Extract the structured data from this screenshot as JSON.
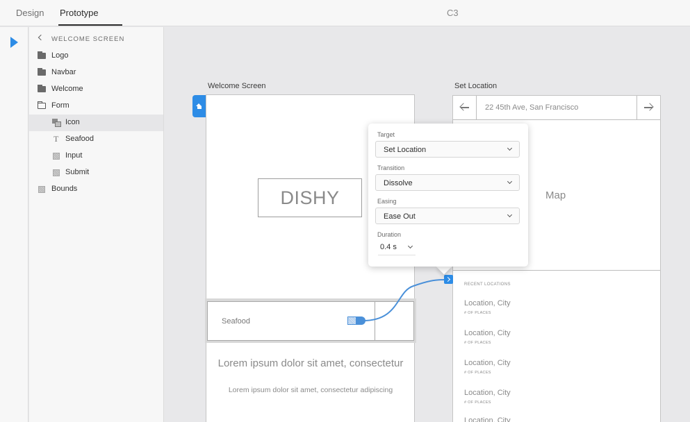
{
  "tabs": {
    "design": "Design",
    "prototype": "Prototype"
  },
  "document_title": "C3",
  "layers_panel": {
    "title": "WELCOME SCREEN",
    "items": [
      {
        "label": "Logo",
        "icon": "folder-filled-icon"
      },
      {
        "label": "Navbar",
        "icon": "folder-filled-icon"
      },
      {
        "label": "Welcome",
        "icon": "folder-filled-icon"
      },
      {
        "label": "Form",
        "icon": "folder-open-icon"
      },
      {
        "label": "Icon",
        "icon": "symbol-icon",
        "selected": true
      },
      {
        "label": "Seafood",
        "icon": "text-icon"
      },
      {
        "label": "Input",
        "icon": "rectangle-icon"
      },
      {
        "label": "Submit",
        "icon": "rectangle-icon"
      },
      {
        "label": "Bounds",
        "icon": "rectangle-icon"
      }
    ]
  },
  "welcome_screen": {
    "title": "Welcome Screen",
    "logo_text": "DISHY",
    "input_label": "Seafood",
    "lorem_big": "Lorem ipsum dolor sit amet, consectetur",
    "lorem_small": "Lorem ipsum dolor sit amet, consectetur adipiscing"
  },
  "set_location": {
    "title": "Set Location",
    "search_value": "22 45th Ave, San Francisco",
    "map_label": "Map",
    "recent_title": "RECENT LOCATIONS",
    "locations": [
      {
        "city": "Location, City",
        "places": "# OF PLACES"
      },
      {
        "city": "Location, City",
        "places": "# OF PLACES"
      },
      {
        "city": "Location, City",
        "places": "# OF PLACES"
      },
      {
        "city": "Location, City",
        "places": "# OF PLACES"
      },
      {
        "city": "Location, City",
        "places": ""
      }
    ]
  },
  "interaction_popover": {
    "target_label": "Target",
    "target_value": "Set Location",
    "transition_label": "Transition",
    "transition_value": "Dissolve",
    "easing_label": "Easing",
    "easing_value": "Ease Out",
    "duration_label": "Duration",
    "duration_value": "0.4 s"
  },
  "colors": {
    "accent": "#2d8ce6",
    "canvas": "#e8e8ea",
    "panel": "#f7f7f7"
  }
}
